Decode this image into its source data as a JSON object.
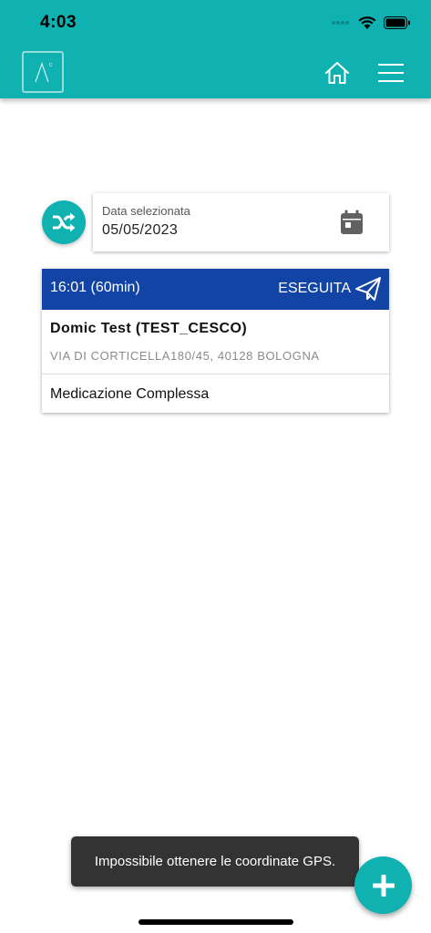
{
  "status_bar": {
    "time": "4:03"
  },
  "header": {
    "logo_icon": "app-logo",
    "home_icon": "home-icon",
    "menu_icon": "hamburger-menu-icon",
    "bg_color": "#0fb1b1"
  },
  "date_picker": {
    "label": "Data selezionata",
    "value": "05/05/2023",
    "icon": "calendar-icon"
  },
  "shuffle_button": {
    "icon": "shuffle-icon"
  },
  "appointment": {
    "time": "16:01 (60min)",
    "status": "ESEGUITA",
    "status_icon": "send-icon",
    "header_color": "#1244a6",
    "patient": "Domic Test (TEST_CESCO)",
    "address": "VIA DI CORTICELLA180/45, 40128 BOLOGNA",
    "service": "Medicazione Complessa"
  },
  "toast": {
    "message": "Impossibile ottenere le coordinate GPS."
  },
  "fab": {
    "icon": "plus-icon"
  }
}
